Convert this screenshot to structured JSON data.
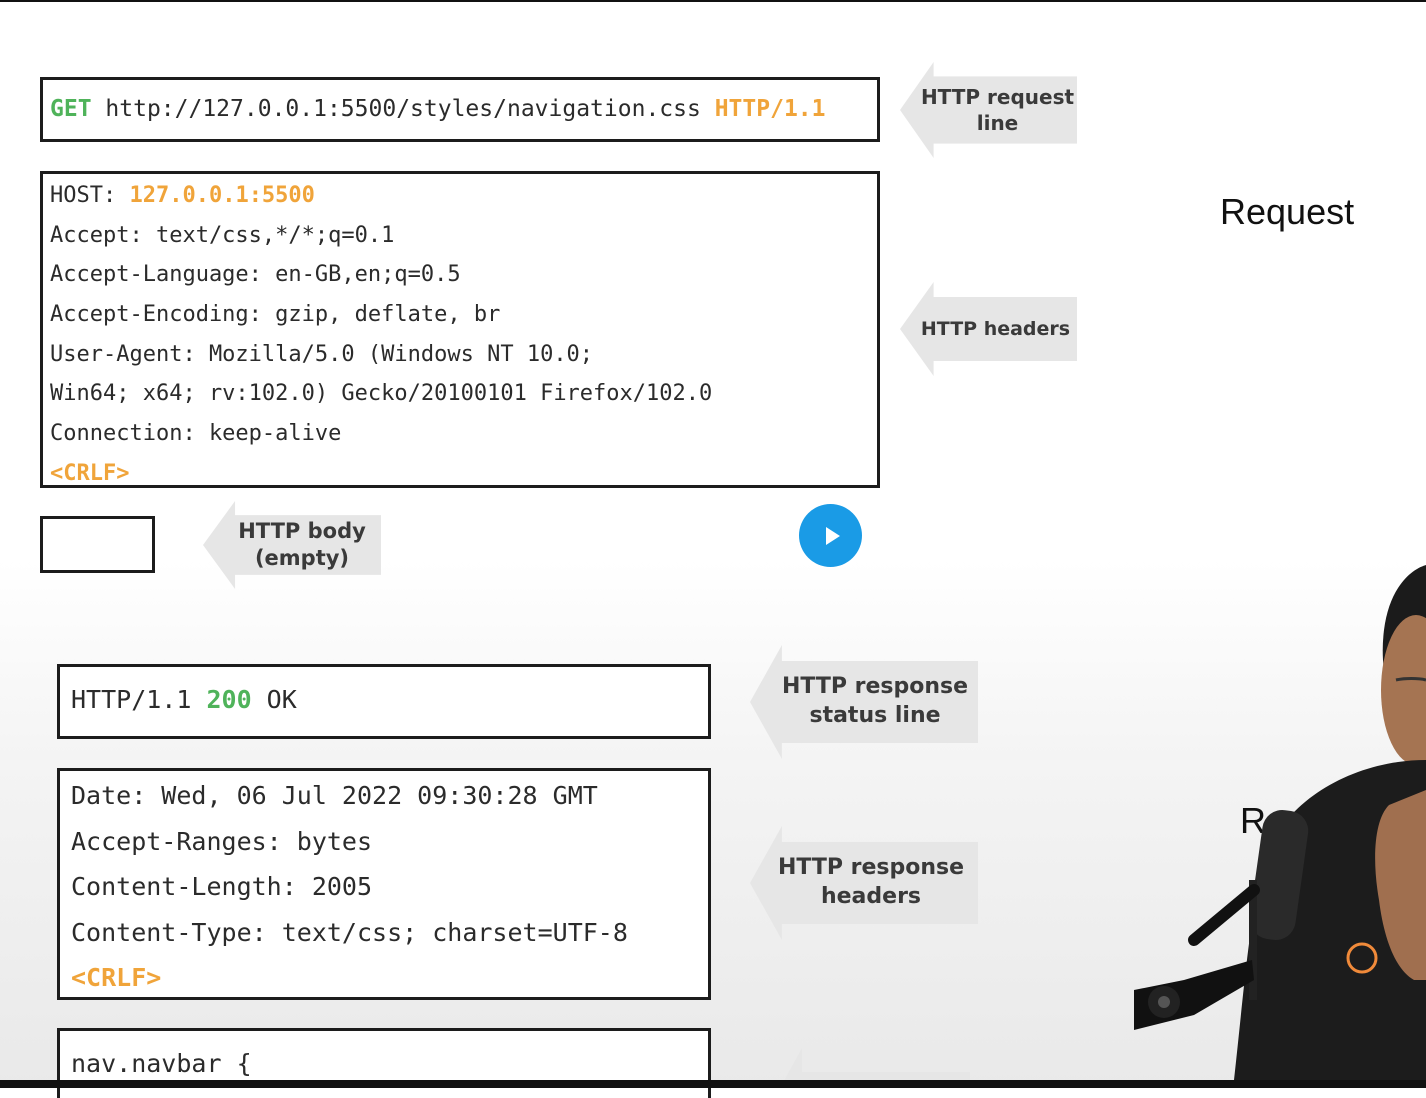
{
  "request": {
    "line": {
      "method": "GET",
      "url": "http://127.0.0.1:5500/styles/navigation.css",
      "version": "HTTP/1.1"
    },
    "headers": [
      {
        "name": "HOST: ",
        "value": "127.0.0.1:5500"
      },
      {
        "text": "Accept: text/css,*/*;q=0.1"
      },
      {
        "text": "Accept-Language: en-GB,en;q=0.5"
      },
      {
        "text": "Accept-Encoding: gzip, deflate, br"
      },
      {
        "text": "User-Agent: Mozilla/5.0 (Windows NT 10.0;"
      },
      {
        "text": "Win64; x64; rv:102.0) Gecko/20100101 Firefox/102.0"
      },
      {
        "text": "Connection: keep-alive"
      }
    ],
    "crlf": "<CRLF>"
  },
  "response": {
    "status": {
      "version": "HTTP/1.1 ",
      "code": "200",
      "reason": " OK"
    },
    "headers": [
      "Date: Wed, 06 Jul 2022 09:30:28 GMT",
      "Accept-Ranges: bytes",
      "Content-Length: 2005",
      "Content-Type: text/css; charset=UTF-8"
    ],
    "crlf": "<CRLF>",
    "body_first_line": "nav.navbar {"
  },
  "annotations": {
    "request_line": [
      "HTTP request",
      "line"
    ],
    "headers": "HTTP headers",
    "body": [
      "HTTP body",
      "(empty)"
    ],
    "response_status": [
      "HTTP response",
      "status line"
    ],
    "response_headers": [
      "HTTP response",
      "headers"
    ]
  },
  "side_labels": {
    "request": "Request",
    "response_partial": "R"
  },
  "video": {
    "play_icon": "play-icon"
  },
  "colors": {
    "method": "#4fb35a",
    "highlight": "#f0a43a",
    "play": "#1a9be6",
    "arrow": "#e6e6e6"
  }
}
